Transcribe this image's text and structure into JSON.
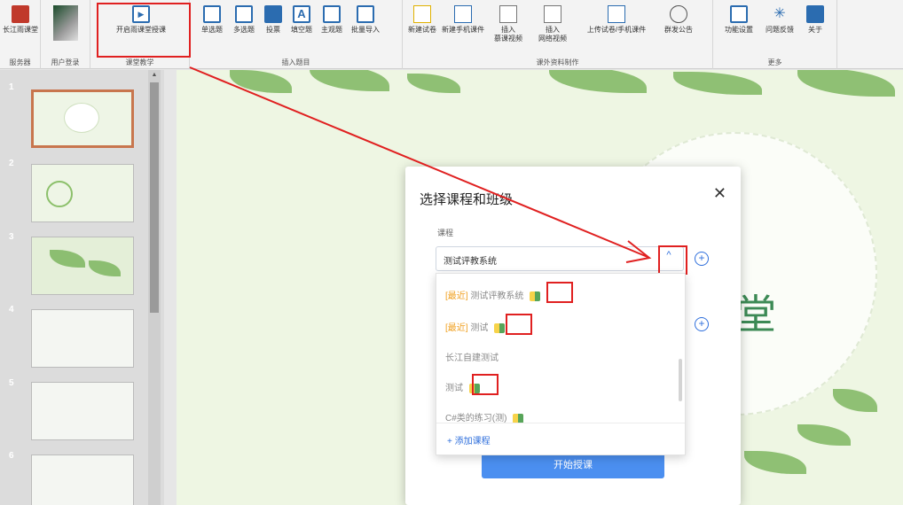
{
  "ribbon": {
    "groups": [
      {
        "label": "服务器"
      },
      {
        "label": "用户登录"
      },
      {
        "label": "课堂教学"
      },
      {
        "label": "插入题目"
      },
      {
        "label": "课外资料制作"
      },
      {
        "label": "更多"
      }
    ],
    "buttons": {
      "changjiang": "长江雨课堂",
      "start_class": "开启雨课堂授课",
      "single": "单选题",
      "multi": "多选题",
      "vote": "投票",
      "fill": "填空题",
      "subjective": "主观题",
      "batch": "批量导入",
      "new_paper": "新建试卷",
      "new_mobile": "新建手机课件",
      "insert_mooc_line1": "插入",
      "insert_mooc_line2": "慕课视频",
      "insert_web_line1": "插入",
      "insert_web_line2": "网络视频",
      "upload": "上传试卷/手机课件",
      "announce": "群发公告",
      "settings": "功能设置",
      "feedback": "问题反馈",
      "about": "关于"
    }
  },
  "slides": {
    "numbers": [
      "1",
      "2",
      "3",
      "4",
      "5",
      "6"
    ]
  },
  "canvas": {
    "big_char": "堂"
  },
  "dialog": {
    "title": "选择课程和班级",
    "close_symbol": "✕",
    "course_label": "课程",
    "course_value": "测试评教系统",
    "arrow_symbol": "^",
    "plus_symbol": "+",
    "start_label": "开始授课"
  },
  "dropdown": {
    "items": [
      {
        "prefix": "[最近]",
        "text": "测试评教系统"
      },
      {
        "prefix": "[最近]",
        "text": "测试"
      },
      {
        "prefix": "",
        "text": "长江自建测试"
      },
      {
        "prefix": "",
        "text": "测试"
      },
      {
        "prefix": "",
        "text": "C#类的练习(测)"
      }
    ],
    "add_label": "+ 添加课程"
  },
  "colors": {
    "accent": "#2f6fdc",
    "highlight": "#e02020",
    "recent": "#f0a020",
    "slide_bg": "#eef6e3"
  }
}
